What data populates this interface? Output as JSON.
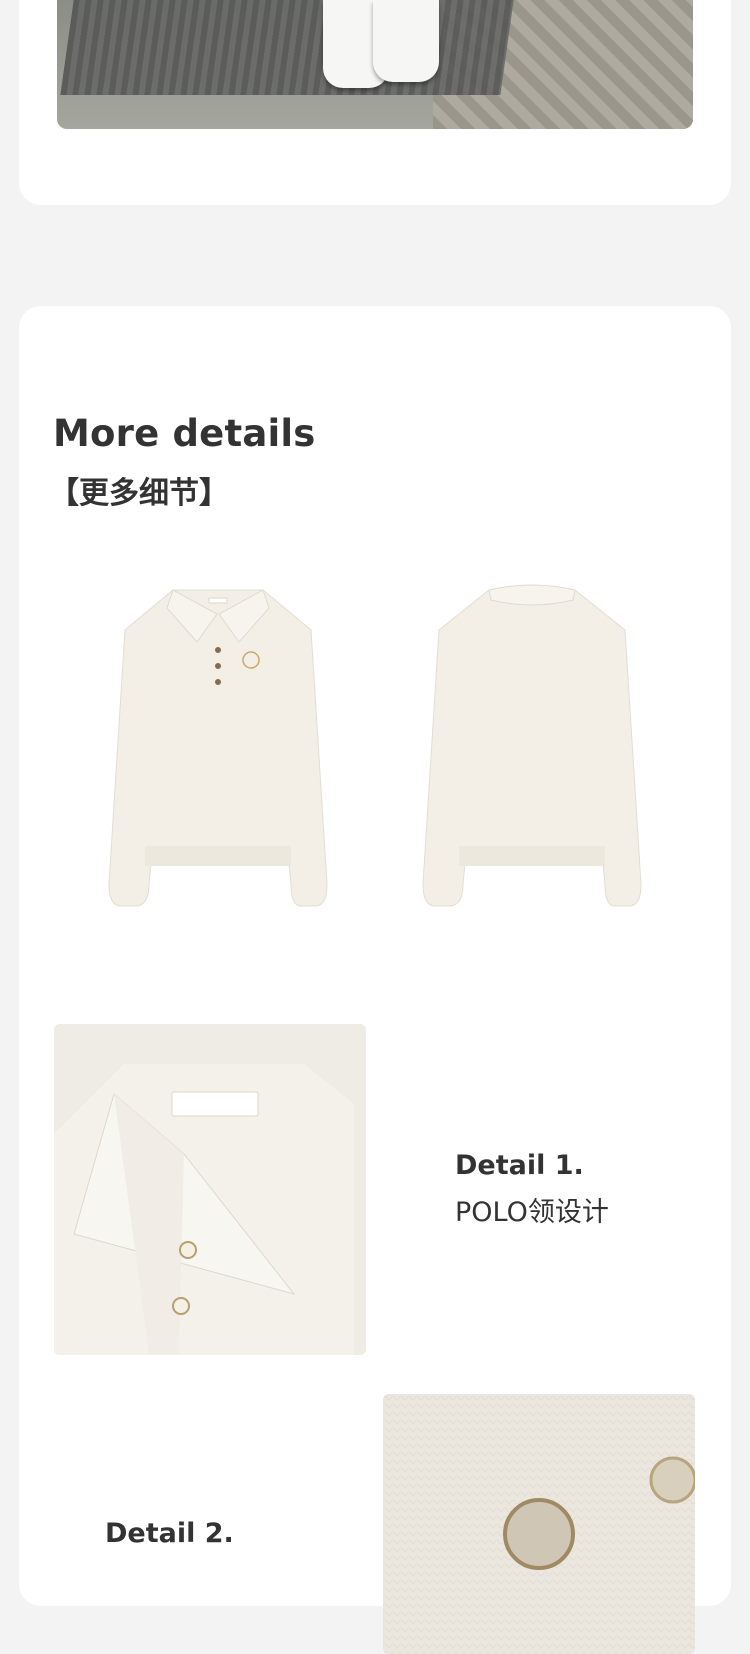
{
  "section": {
    "title": "More details",
    "subtitle": "【更多细节】"
  },
  "details": [
    {
      "title": "Detail 1.",
      "description": "POLO领设计"
    },
    {
      "title": "Detail 2."
    }
  ],
  "colors": {
    "page_background": "#f3f3f3",
    "card": "#ffffff",
    "text": "#333333",
    "sweater": "#f2eee6"
  }
}
